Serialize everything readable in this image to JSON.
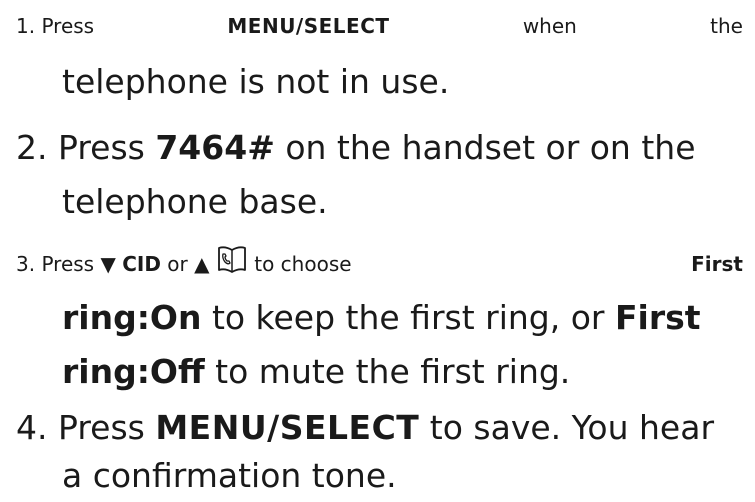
{
  "steps": [
    {
      "number": "1.",
      "line1": {
        "w1": "Press",
        "key": "MENU/SELECT",
        "w2": "when",
        "w3": "the"
      },
      "line2": "telephone is not in use."
    },
    {
      "number": "2.",
      "line1_a": "Press ",
      "code": "7464#",
      "line1_b": " on the handset or on the",
      "line2": "telephone base."
    },
    {
      "number": "3.",
      "line1_a": "Press ",
      "down_symbol": "▼",
      "cid": "CID",
      "or": " or ",
      "up_symbol": "▲",
      "line1_b": " to choose ",
      "first_a": "First",
      "line2_bold": "ring:On",
      "line2_rest": " to keep the first ring, or ",
      "first_b": "First",
      "line3_bold": "ring:Off",
      "line3_rest": " to mute the first ring."
    },
    {
      "number": "4.",
      "line1_a": "Press ",
      "key": "MENU/SELECT",
      "line1_b": " to save. You hear",
      "line2": "a confirmation tone."
    }
  ],
  "icons": {
    "directory": "phonebook-icon"
  },
  "colors": {
    "text": "#1a1a1a",
    "background": "#ffffff"
  }
}
